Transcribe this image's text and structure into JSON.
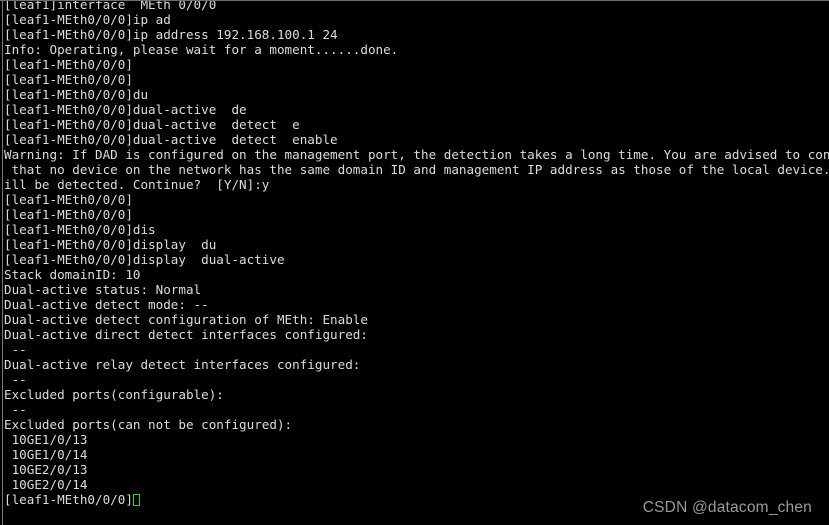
{
  "terminal": {
    "background_color": "#000000",
    "text_color": "#dcdcdc",
    "cursor_color": "#27d427",
    "border_color": "#7a7a7a",
    "lines": [
      "[leaf1]interface  MEth 0/0/0",
      "[leaf1-MEth0/0/0]ip ad",
      "[leaf1-MEth0/0/0]ip address 192.168.100.1 24",
      "Info: Operating, please wait for a moment......done.",
      "[leaf1-MEth0/0/0]",
      "[leaf1-MEth0/0/0]",
      "[leaf1-MEth0/0/0]du",
      "[leaf1-MEth0/0/0]dual-active  de",
      "[leaf1-MEth0/0/0]dual-active  detect  e",
      "[leaf1-MEth0/0/0]dual-active  detect  enable",
      "Warning: If DAD is configured on the management port, the detection takes a long time. You are advised to configure DAD on the interface that supports DAD. Please ensure",
      " that no device on the network has the same domain ID and management IP address as those of the local device. Otherwise, the dual-active situation will not",
      "ill be detected. Continue?  [Y/N]:y",
      "[leaf1-MEth0/0/0]",
      "[leaf1-MEth0/0/0]",
      "[leaf1-MEth0/0/0]dis",
      "[leaf1-MEth0/0/0]display  du",
      "[leaf1-MEth0/0/0]display  dual-active",
      "Stack domainID: 10",
      "Dual-active status: Normal",
      "Dual-active detect mode: --",
      "Dual-active detect configuration of MEth: Enable",
      "Dual-active direct detect interfaces configured:",
      " --",
      "Dual-active relay detect interfaces configured:",
      " --",
      "Excluded ports(configurable):",
      " --",
      "Excluded ports(can not be configured):",
      " 10GE1/0/13",
      " 10GE1/0/14",
      " 10GE2/0/13",
      " 10GE2/0/14"
    ],
    "prompt_line": "[leaf1-MEth0/0/0]",
    "cursor_glyph": "block-outline-cursor"
  },
  "watermark": {
    "text": "CSDN @datacom_chen"
  }
}
